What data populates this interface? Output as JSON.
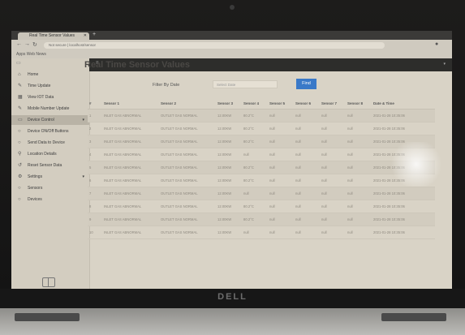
{
  "device": {
    "brand": "DELL"
  },
  "browser": {
    "tab_title": "Real Time Sensor Values",
    "url": "Not secure | localhost/sensor",
    "bookmarks": "Apps  Web News"
  },
  "sidebar": {
    "items": [
      {
        "label": "Home",
        "icon": "home-icon",
        "glyph": "⌂"
      },
      {
        "label": "Time Update",
        "icon": "edit-icon",
        "glyph": "✎"
      },
      {
        "label": "View IOT Data",
        "icon": "grid-icon",
        "glyph": "▦"
      },
      {
        "label": "Mobile Number Update",
        "icon": "edit-icon",
        "glyph": "✎"
      },
      {
        "label": "Device Control",
        "icon": "monitor-icon",
        "glyph": "▭"
      },
      {
        "label": "Device ON/Off Buttons",
        "icon": "circle-icon",
        "glyph": "○"
      },
      {
        "label": "Send Data to Device",
        "icon": "circle-icon",
        "glyph": "○"
      },
      {
        "label": "Location Details",
        "icon": "pin-icon",
        "glyph": "⚲"
      },
      {
        "label": "Reset Sensor Data",
        "icon": "reset-icon",
        "glyph": "↺"
      },
      {
        "label": "Settings",
        "icon": "gear-icon",
        "glyph": "⚙"
      },
      {
        "label": "Sensors",
        "icon": "circle-icon",
        "glyph": "○"
      },
      {
        "label": "Devices",
        "icon": "circle-icon",
        "glyph": "○"
      }
    ]
  },
  "main": {
    "title": "Real Time Sensor Values",
    "filter": {
      "label": "Filter By Date",
      "placeholder": "Select Date",
      "button": "Find"
    },
    "table": {
      "headers": [
        "#",
        "Sensor 1",
        "Sensor 2",
        "Sensor 3",
        "Sensor 4",
        "Sensor 5",
        "Sensor 6",
        "Sensor 7",
        "Sensor 8",
        "Date & Time"
      ],
      "rows": [
        [
          "1",
          "INLET GAS ABNORMAL",
          "OUTLET GAS NORMAL",
          "12.00KW",
          "80.2°C",
          "null",
          "null",
          "null",
          "null",
          "2021-01-28 10:35:06"
        ],
        [
          "2",
          "INLET GAS ABNORMAL",
          "OUTLET GAS NORMAL",
          "12.00KW",
          "80.2°C",
          "null",
          "null",
          "null",
          "null",
          "2021-01-28 10:35:06"
        ],
        [
          "3",
          "INLET GAS ABNORMAL",
          "OUTLET GAS NORMAL",
          "12.00KW",
          "80.2°C",
          "null",
          "null",
          "null",
          "null",
          "2021-01-28 10:35:06"
        ],
        [
          "4",
          "INLET GAS ABNORMAL",
          "OUTLET GAS NORMAL",
          "12.00KW",
          "null",
          "null",
          "null",
          "null",
          "null",
          "2021-01-28 10:35:06"
        ],
        [
          "5",
          "INLET GAS ABNORMAL",
          "OUTLET GAS NORMAL",
          "12.00KW",
          "80.2°C",
          "null",
          "null",
          "null",
          "null",
          "2021-01-28 10:35:06"
        ],
        [
          "6",
          "INLET GAS ABNORMAL",
          "OUTLET GAS NORMAL",
          "12.00KW",
          "80.2°C",
          "null",
          "null",
          "null",
          "null",
          "2021-01-28 10:35:06"
        ],
        [
          "7",
          "INLET GAS ABNORMAL",
          "OUTLET GAS NORMAL",
          "12.00KW",
          "null",
          "null",
          "null",
          "null",
          "null",
          "2021-01-28 10:35:06"
        ],
        [
          "8",
          "INLET GAS ABNORMAL",
          "OUTLET GAS NORMAL",
          "12.00KW",
          "80.2°C",
          "null",
          "null",
          "null",
          "null",
          "2021-01-28 10:35:06"
        ],
        [
          "9",
          "INLET GAS ABNORMAL",
          "OUTLET GAS NORMAL",
          "12.00KW",
          "80.2°C",
          "null",
          "null",
          "null",
          "null",
          "2021-01-28 10:35:06"
        ],
        [
          "10",
          "INLET GAS ABNORMAL",
          "OUTLET GAS NORMAL",
          "12.00KW",
          "null",
          "null",
          "null",
          "null",
          "null",
          "2021-01-28 10:35:06"
        ]
      ]
    }
  },
  "colors": {
    "accent": "#3a79c8",
    "topbar": "#2d2d2b"
  }
}
